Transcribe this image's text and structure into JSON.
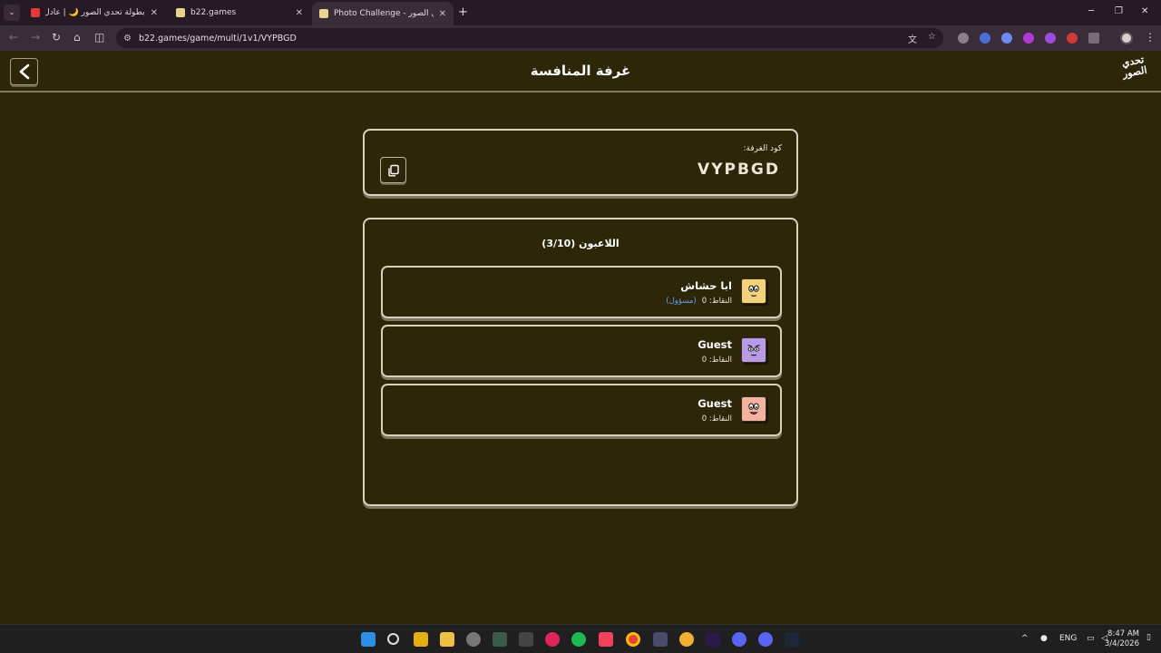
{
  "browser": {
    "tabs": [
      {
        "title": "بطولة تحدي الصور 🌙 | عادل و...",
        "active": false,
        "favicon_color": "#e53935"
      },
      {
        "title": "b22.games",
        "active": false,
        "favicon_color": "#e8d48a"
      },
      {
        "title": "Photo Challenge - تحدي الصور",
        "active": true,
        "favicon_color": "#e8d48a"
      }
    ],
    "url": "b22.games/game/multi/1v1/VYPBGD"
  },
  "header": {
    "title": "غرفة المنافسة",
    "logo_text": "تحدي الصور"
  },
  "room": {
    "code_label": "كود الغرفة:",
    "code": "VYPBGD"
  },
  "players": {
    "title": "اللاعبون (3/10)",
    "list": [
      {
        "name": "ابا حشاش",
        "score_text": "النقاط: 0",
        "host_label": "(مسؤول)",
        "avatar": "yellow-face-icon",
        "avatar_color": "#f3d27a"
      },
      {
        "name": "Guest",
        "score_text": "النقاط: 0",
        "host_label": "",
        "avatar": "purple-face-icon",
        "avatar_color": "#b79be6"
      },
      {
        "name": "Guest",
        "score_text": "النقاط: 0",
        "host_label": "",
        "avatar": "peach-face-icon",
        "avatar_color": "#f3b3a0"
      }
    ]
  },
  "taskbar": {
    "lang": "ENG",
    "time": "8:47 AM",
    "date": "3/4/2026"
  }
}
